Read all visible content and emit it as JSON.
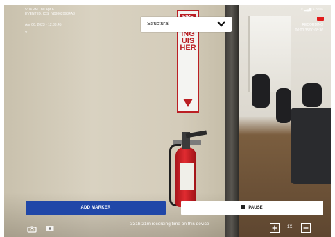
{
  "status_bar": {
    "time": "5:08 PM  Thu Apr 6",
    "right": "▾ ▂▄▆ ◔ 85%"
  },
  "event": {
    "id": "EVENT ID: IQS_N888620984A3",
    "datetime": "Apr 06, 2023 - 12:33:45",
    "extra": "Y"
  },
  "recording": {
    "label": "RECORDING",
    "elapsed": "00:00:35/00:08:36",
    "icon": "record-icon",
    "color": "#e11c1c"
  },
  "dropdown": {
    "selected": "Structural",
    "icon": "chevron-down-icon"
  },
  "sign": {
    "header": "FIRE",
    "word": "EXTINGUISHER"
  },
  "buttons": {
    "add_marker": "ADD MARKER",
    "pause": "PAUSE",
    "add_marker_color": "#2047a8"
  },
  "footer": {
    "remaining_text": "331h 21m recording time on this device",
    "zoom_level": "1X",
    "camera_icon": "camera-switch-icon",
    "photo_icon": "photo-icon",
    "zoom_in_icon": "zoom-in-icon",
    "zoom_out_icon": "zoom-out-icon"
  }
}
